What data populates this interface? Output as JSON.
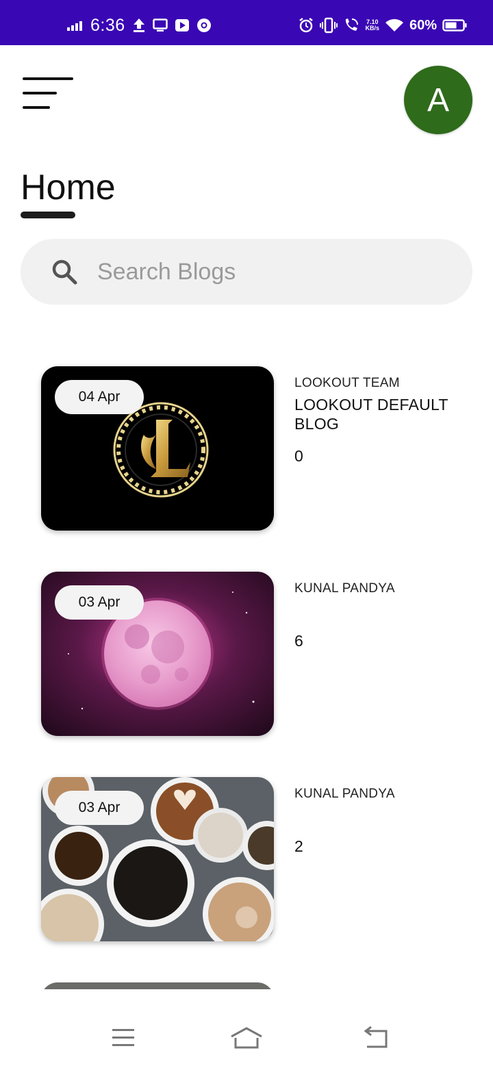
{
  "status_bar": {
    "time": "6:36",
    "net_speed_value": "7.10",
    "net_speed_unit": "KB/s",
    "battery": "60%",
    "background": "#3a07b4"
  },
  "header": {
    "avatar_letter": "A",
    "avatar_color": "#2e6b1a"
  },
  "page": {
    "title": "Home"
  },
  "search": {
    "placeholder": "Search Blogs",
    "value": ""
  },
  "blogs": [
    {
      "date": "04 Apr",
      "author": "LOOKOUT TEAM",
      "title": "LOOKOUT DEFAULT BLOG",
      "count": "0",
      "image": "lookout-logo"
    },
    {
      "date": "03 Apr",
      "author": "KUNAL PANDYA",
      "title": "",
      "count": "6",
      "image": "pink-moon"
    },
    {
      "date": "03 Apr",
      "author": "KUNAL PANDYA",
      "title": "",
      "count": "2",
      "image": "coffee-cups"
    }
  ],
  "nav": {
    "icons": [
      "menu-icon",
      "home-icon",
      "back-icon"
    ]
  }
}
